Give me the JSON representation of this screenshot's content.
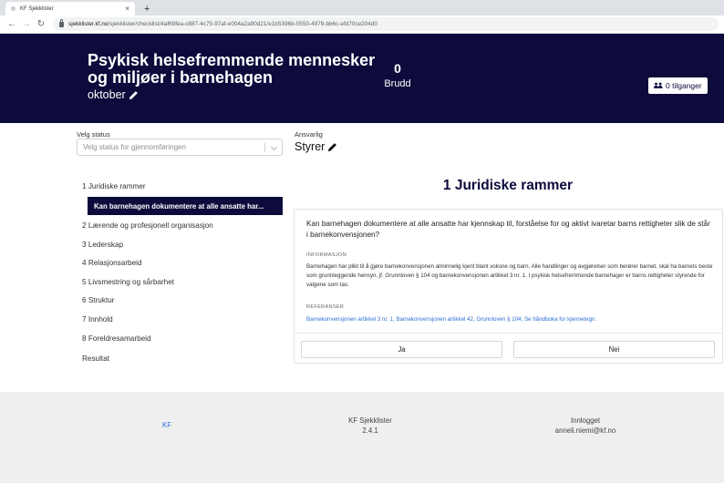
{
  "browser": {
    "tab_title": "KF Sjekklister",
    "tab_close": "×",
    "new_tab": "+",
    "url_host": "sjekklister.kf.no",
    "url_path": "/sjekklister/checklist/4af69fea-c887-4c75-97af-e004a2a90d21/e1b5396b-0550-4979-bb6c-efd70ce204d0"
  },
  "header": {
    "title": "Psykisk helsefremmende mennesker og miljøer i barnehagen",
    "subtitle": "oktober",
    "violations_count": "0",
    "violations_label": "Brudd",
    "access_button": "0 tilganger"
  },
  "status": {
    "label": "Velg status",
    "placeholder": "Velg status for gjennomføringen",
    "responsible_label": "Ansvarlig",
    "responsible_value": "Styrer"
  },
  "nav": {
    "items": [
      "1 Juridiske rammer",
      "2 Lærende og profesjonell organisasjon",
      "3 Lederskap",
      "4 Relasjonsarbeid",
      "5 Livsmestring og sårbarhet",
      "6 Struktur",
      "7 Innhold",
      "8 Foreldresamarbeid",
      "Resultat"
    ],
    "active_sub": "Kan barnehagen dokumentere at alle ansatte har..."
  },
  "main": {
    "section_title": "1 Juridiske rammer",
    "question": "Kan barnehagen dokumentere at alle ansatte har kjennskap til, forståelse for og aktivt ivaretar barns rettigheter slik de står i barnekonvensjonen?",
    "info_heading": "INFORMASJON",
    "info_text": "Barnehagen har plikt til å gjøre barnekonvensjonen alminnelig kjent blant voksne og barn. Alle handlinger og avgjørelser som berører barnet, skal ha barnets beste som grunnleggende hensyn, jf. Grunnloven § 104 og barnekonvensjonen artikkel 3 nr. 1. I psykisk helsefremmende barnehager er barns rettigheter styrende for valgene som tas.",
    "refs_heading": "REFERANSER",
    "refs_text": "Barnekonvensjonen artikkel 3 nr. 1, Barnekonvensjonen artikkel 42, Grunnloven § 104, Se håndboka for kjennetegn.",
    "yes_button": "Ja",
    "no_button": "Nei"
  },
  "footer": {
    "kf_link": "KF",
    "app_name": "KF Sjekklister",
    "version": "2.4.1",
    "logged_in_label": "Innlogget",
    "user_email": "anneli.niemi@kf.no"
  },
  "colors": {
    "brand_navy": "#0c0b3c",
    "link_blue": "#2f6fd6",
    "footer_bg": "#efefef"
  }
}
